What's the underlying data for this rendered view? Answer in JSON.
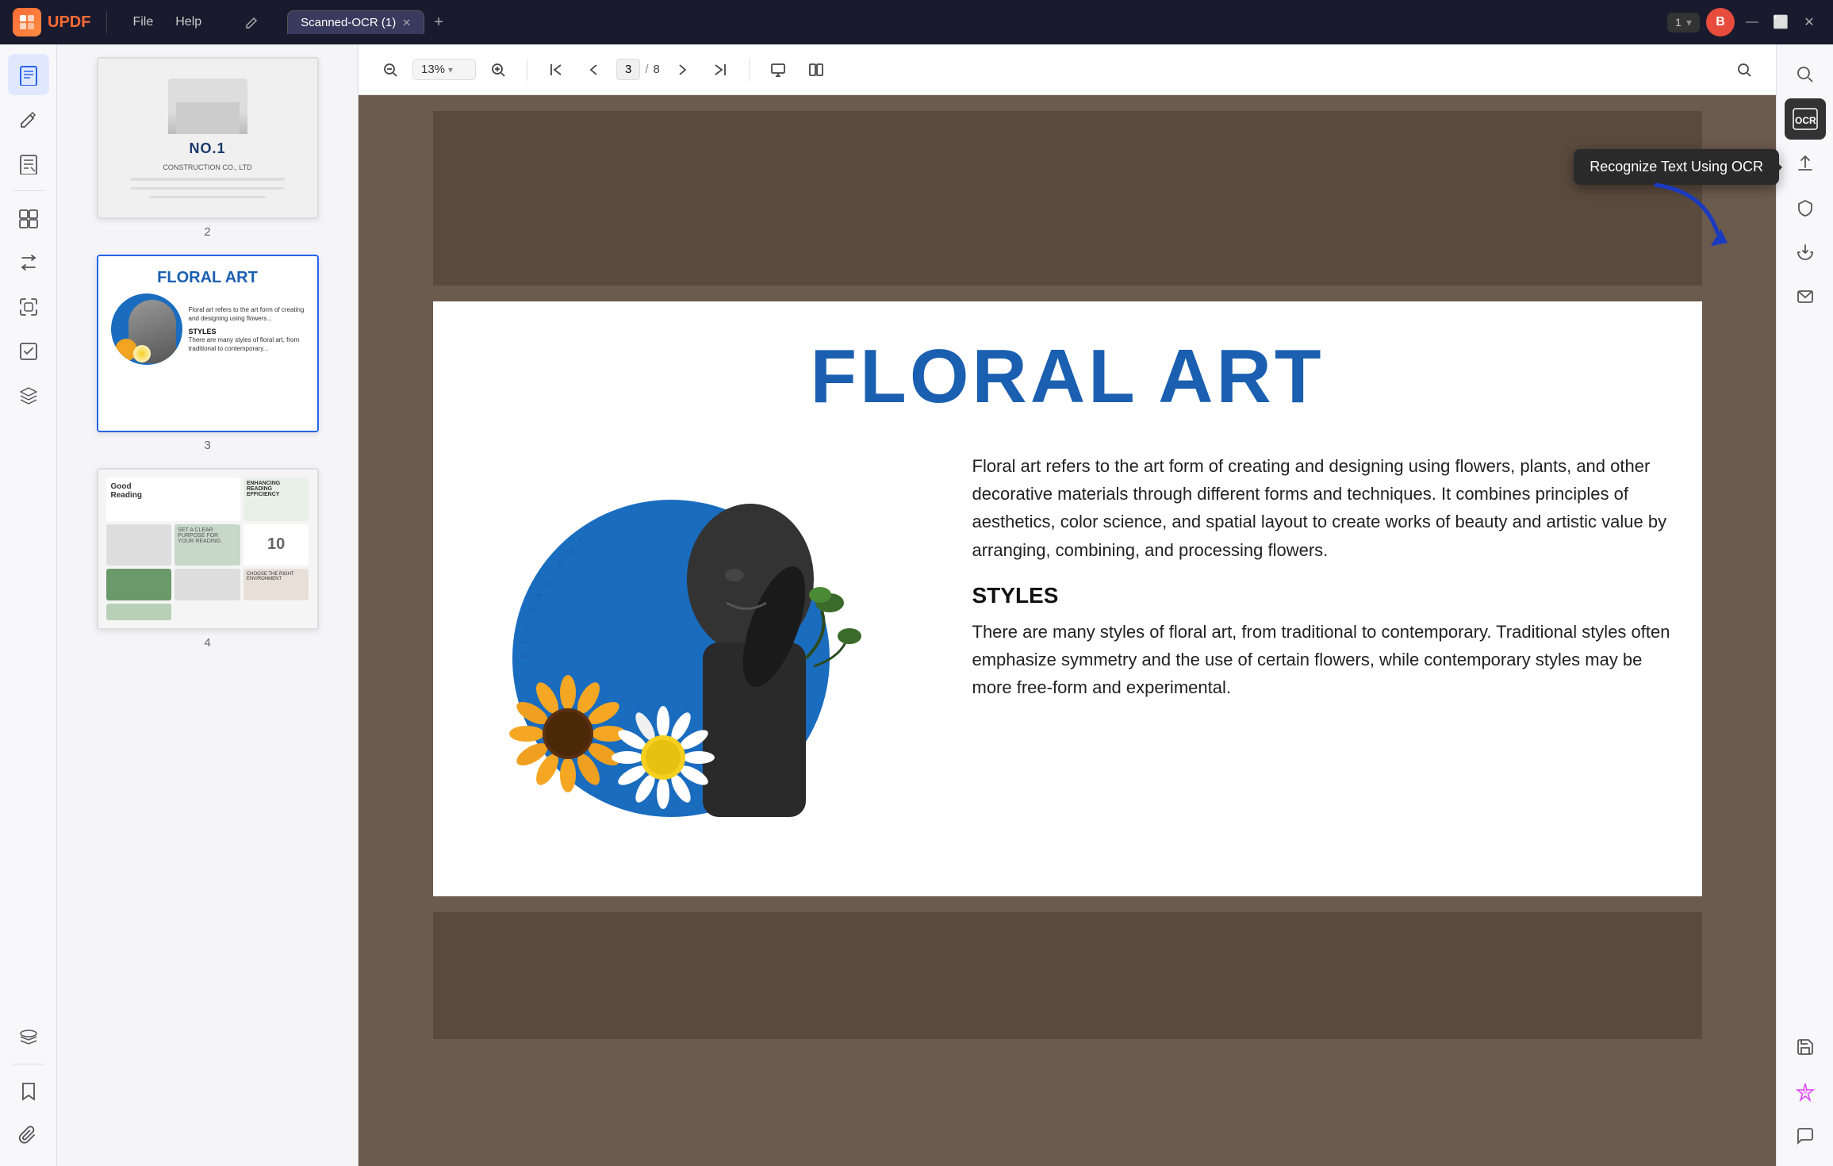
{
  "app": {
    "name": "UPDF",
    "logo_text": "UPDF"
  },
  "title_bar": {
    "menu_items": [
      "File",
      "Help"
    ],
    "tab_name": "Scanned-OCR (1)",
    "page_selector": "1",
    "user_initial": "B"
  },
  "toolbar": {
    "zoom_out_label": "−",
    "zoom_level": "13%",
    "zoom_in_label": "+",
    "first_page_label": "⟨⟨",
    "prev_page_label": "⟨",
    "current_page": "3",
    "total_pages": "8",
    "next_page_label": "⟩",
    "last_page_label": "⟩⟩",
    "view_mode_label": "⊞",
    "columns_label": "☷"
  },
  "sidebar": {
    "icons": [
      {
        "name": "read-icon",
        "symbol": "📖",
        "active": true
      },
      {
        "name": "annotate-icon",
        "symbol": "✏️",
        "active": false
      },
      {
        "name": "edit-icon",
        "symbol": "📝",
        "active": false
      },
      {
        "name": "organize-icon",
        "symbol": "☰",
        "active": false
      },
      {
        "name": "convert-icon",
        "symbol": "⇄",
        "active": false
      },
      {
        "name": "compress-icon",
        "symbol": "⊞",
        "active": false
      },
      {
        "name": "form-icon",
        "symbol": "☑",
        "active": false
      },
      {
        "name": "layers-icon",
        "symbol": "⧉",
        "active": false
      }
    ],
    "bottom_icons": [
      {
        "name": "bookmark-icon",
        "symbol": "🔖"
      },
      {
        "name": "attach-icon",
        "symbol": "📎"
      }
    ]
  },
  "thumbnails": [
    {
      "page_num": "2",
      "type": "construction"
    },
    {
      "page_num": "3",
      "type": "floral",
      "selected": true
    },
    {
      "page_num": "4",
      "type": "reading"
    }
  ],
  "main_page": {
    "title": "FLORAL ART",
    "description": "Floral art refers to the art form of creating and designing using flowers, plants, and other decorative materials through different forms and techniques. It combines principles of aesthetics, color science, and spatial layout to create works of beauty and artistic value by arranging, combining, and processing flowers.",
    "styles_heading": "STYLES",
    "styles_text": "There are many styles of floral art, from traditional to contemporary. Traditional styles often emphasize symmetry and the use of certain flowers, while contemporary styles may be more free-form and experimental.",
    "arc_text": "FLORAL ART"
  },
  "right_sidebar": {
    "ocr_tooltip": "Recognize Text Using OCR",
    "buttons": [
      {
        "name": "search-icon",
        "symbol": "🔍"
      },
      {
        "name": "ocr-icon",
        "symbol": "OCR",
        "active": true
      },
      {
        "name": "share-icon",
        "symbol": "↑"
      },
      {
        "name": "protect-icon",
        "symbol": "🔒"
      },
      {
        "name": "export-icon",
        "symbol": "⊕"
      },
      {
        "name": "email-icon",
        "symbol": "✉"
      },
      {
        "name": "save-icon",
        "symbol": "💾"
      },
      {
        "name": "ai-icon",
        "symbol": "✦"
      },
      {
        "name": "comment-icon",
        "symbol": "💬"
      }
    ]
  },
  "colors": {
    "accent_blue": "#1a5fb0",
    "dark_bg": "#1a1a2e",
    "wood_bg": "#6b5a4e",
    "ocr_tooltip_bg": "#2a2a2a",
    "arrow_color": "#1a3abf"
  }
}
